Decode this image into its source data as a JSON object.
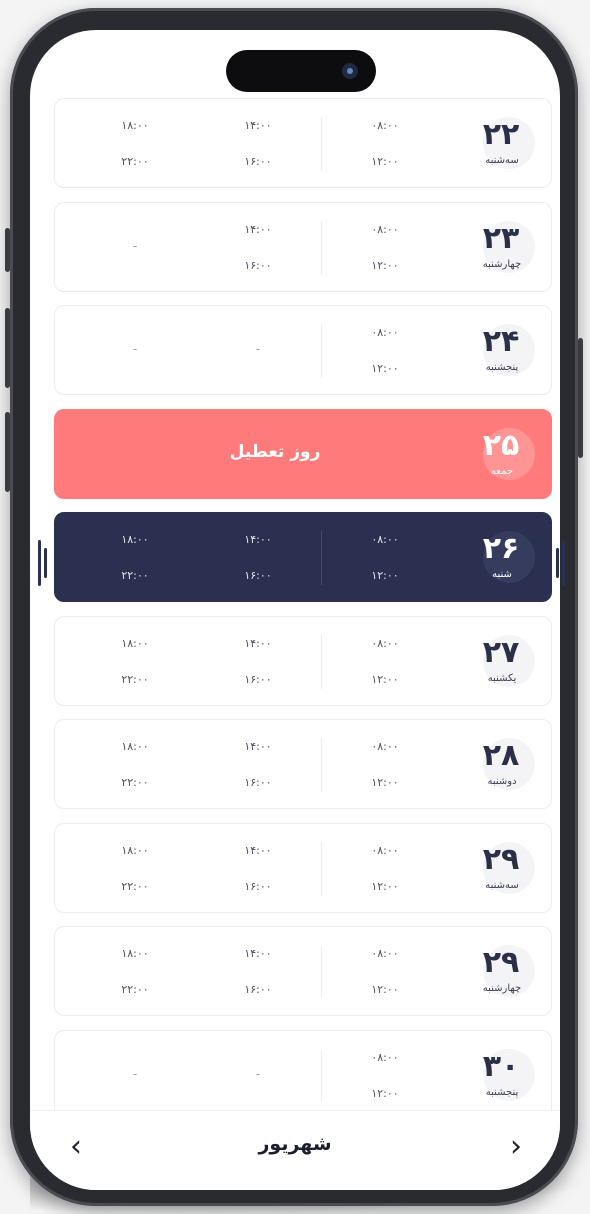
{
  "calendar": {
    "month": "شهریور",
    "prev_icon": "chevron-left-icon",
    "next_icon": "chevron-right-icon",
    "holiday_label": "روز تعطیل",
    "days": [
      {
        "num": "۲۲",
        "name": "سه‌شنبه",
        "slots": [
          [
            "۰۸:۰۰",
            "۱۲:۰۰"
          ],
          [
            "۱۴:۰۰",
            "۱۶:۰۰"
          ],
          [
            "۱۸:۰۰",
            "۲۲:۰۰"
          ]
        ]
      },
      {
        "num": "۲۳",
        "name": "چهارشنبه",
        "slots": [
          [
            "۰۸:۰۰",
            "۱۲:۰۰"
          ],
          [
            "۱۴:۰۰",
            "۱۶:۰۰"
          ],
          [
            "-"
          ]
        ]
      },
      {
        "num": "۲۴",
        "name": "پنجشنبه",
        "slots": [
          [
            "۰۸:۰۰",
            "۱۲:۰۰"
          ],
          [
            "-"
          ],
          [
            "-"
          ]
        ]
      },
      {
        "num": "۲۵",
        "name": "جمعه",
        "holiday": true
      },
      {
        "num": "۲۶",
        "name": "شنبه",
        "selected": true,
        "slots": [
          [
            "۰۸:۰۰",
            "۱۲:۰۰"
          ],
          [
            "۱۴:۰۰",
            "۱۶:۰۰"
          ],
          [
            "۱۸:۰۰",
            "۲۲:۰۰"
          ]
        ]
      },
      {
        "num": "۲۷",
        "name": "یکشنبه",
        "slots": [
          [
            "۰۸:۰۰",
            "۱۲:۰۰"
          ],
          [
            "۱۴:۰۰",
            "۱۶:۰۰"
          ],
          [
            "۱۸:۰۰",
            "۲۲:۰۰"
          ]
        ]
      },
      {
        "num": "۲۸",
        "name": "دوشنبه",
        "slots": [
          [
            "۰۸:۰۰",
            "۱۲:۰۰"
          ],
          [
            "۱۴:۰۰",
            "۱۶:۰۰"
          ],
          [
            "۱۸:۰۰",
            "۲۲:۰۰"
          ]
        ]
      },
      {
        "num": "۲۹",
        "name": "سه‌شنبه",
        "slots": [
          [
            "۰۸:۰۰",
            "۱۲:۰۰"
          ],
          [
            "۱۴:۰۰",
            "۱۶:۰۰"
          ],
          [
            "۱۸:۰۰",
            "۲۲:۰۰"
          ]
        ]
      },
      {
        "num": "۲۹",
        "name": "چهارشنبه",
        "slots": [
          [
            "۰۸:۰۰",
            "۱۲:۰۰"
          ],
          [
            "۱۴:۰۰",
            "۱۶:۰۰"
          ],
          [
            "۱۸:۰۰",
            "۲۲:۰۰"
          ]
        ]
      },
      {
        "num": "۳۰",
        "name": "پنجشنبه",
        "slots": [
          [
            "۰۸:۰۰",
            "۱۲:۰۰"
          ],
          [
            "-"
          ],
          [
            "-"
          ]
        ]
      }
    ]
  },
  "colors": {
    "holiday": "#ff7b7b",
    "selected": "#2b3050",
    "text_dark": "#2b3048"
  }
}
